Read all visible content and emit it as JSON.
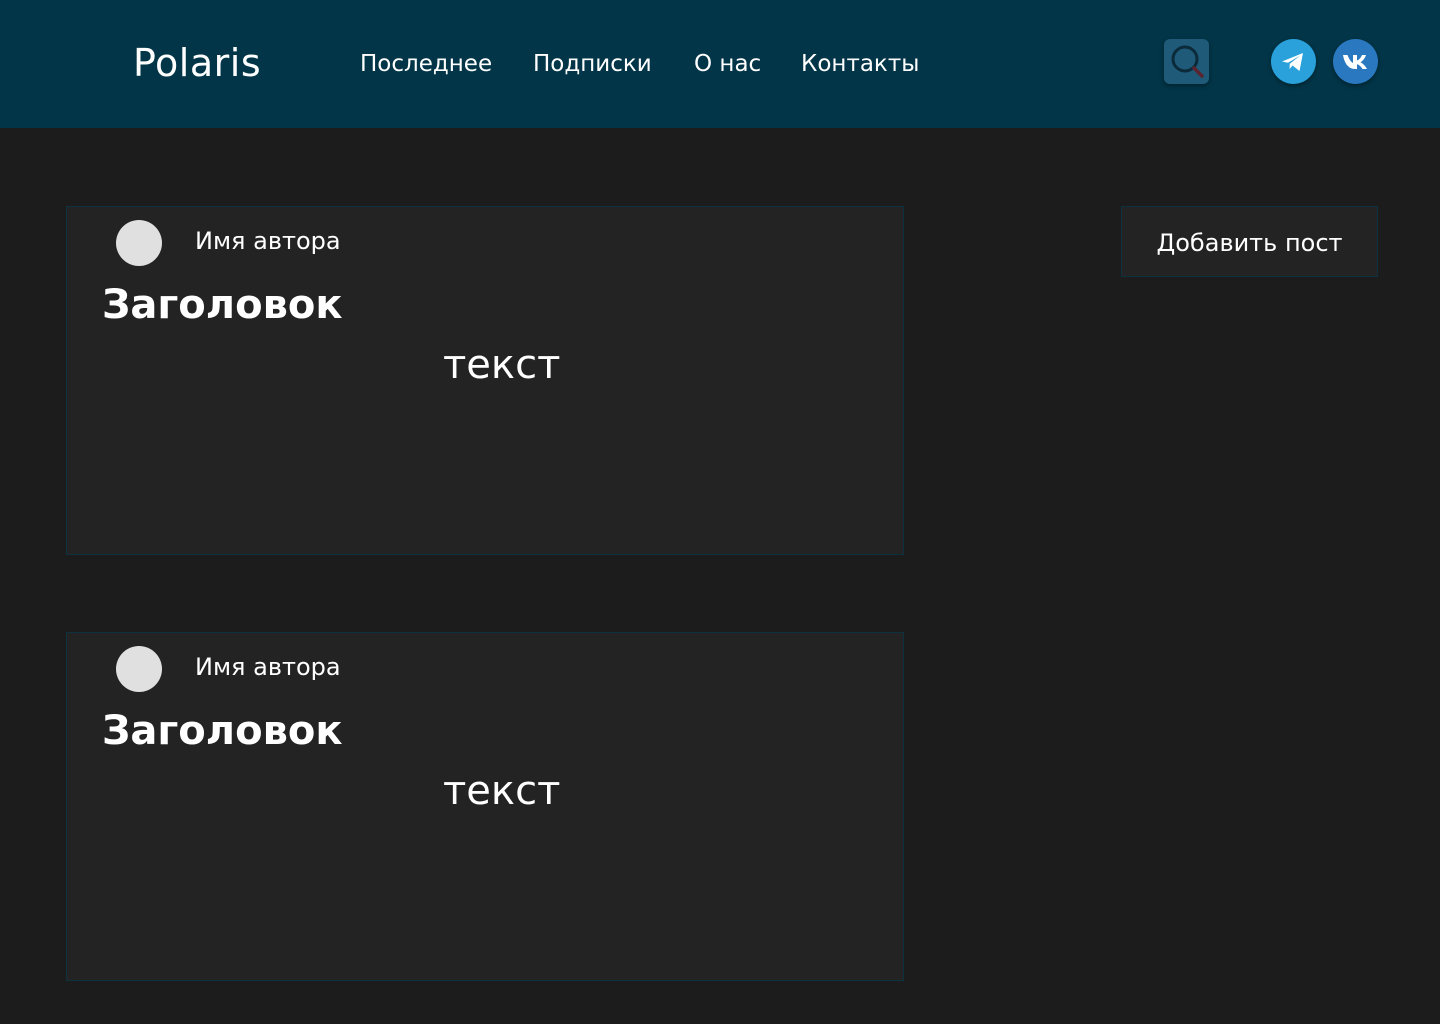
{
  "header": {
    "logo": "Polaris",
    "nav": [
      "Последнее",
      "Подписки",
      "О нас",
      "Контакты"
    ],
    "search_icon": "search-icon",
    "social": [
      "telegram-icon",
      "vk-icon"
    ]
  },
  "posts": [
    {
      "author": "Имя автора",
      "title": "Заголовок",
      "text": "текст"
    },
    {
      "author": "Имя автора",
      "title": "Заголовок",
      "text": "текст"
    }
  ],
  "sidebar": {
    "add_post_label": "Добавить пост"
  },
  "colors": {
    "header_bg": "#023547",
    "page_bg": "#1c1c1c",
    "card_bg": "#232323",
    "card_border": "#0e3140",
    "telegram": "#2aa1da",
    "vk": "#2a79c0",
    "search_bg": "#1f5b78"
  }
}
